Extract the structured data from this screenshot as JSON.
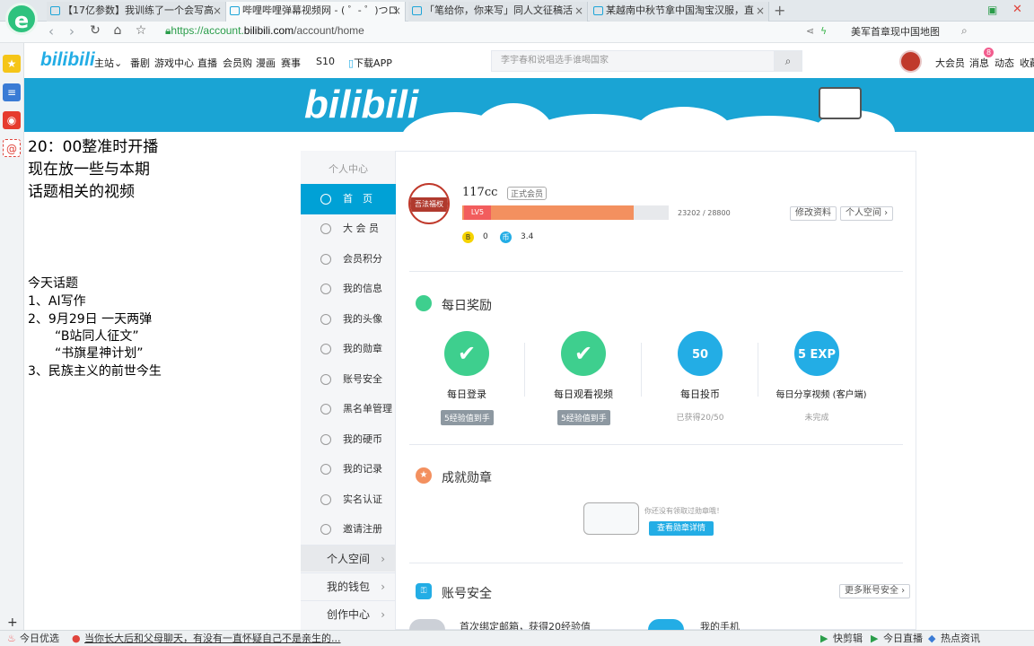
{
  "browser": {
    "tabs": [
      {
        "title": "【17亿参数】我训练了一个会写高"
      },
      {
        "title": "哔哩哔哩弹幕视频网 - ( ゜- ゜)つロ"
      },
      {
        "title": "「笔给你，你来写」同人文征稿活"
      },
      {
        "title": "某越南中秋节拿中国淘宝汉服，直"
      }
    ],
    "url_scheme": "https://account.",
    "url_domain": "bilibili.com",
    "url_path": "/account/home",
    "search_text": "美军首章现中国地图",
    "status_items": [
      "今日优选",
      "当你长大后和父母聊天，有没有一直怀疑自己不是亲生的...",
      "快剪辑",
      "今日直播",
      "热点资讯"
    ]
  },
  "site_header": {
    "logo": "bilibili",
    "nav": [
      "主站",
      "番剧",
      "游戏中心",
      "直播",
      "会员购",
      "漫画",
      "赛事",
      "S10",
      "下载APP"
    ],
    "search_placeholder": "李宇春和说唱选手谁喝国家",
    "right_links": [
      "大会员",
      "消息",
      "动态",
      "收藏"
    ],
    "message_count": "8"
  },
  "banner": {
    "logo": "bilibili"
  },
  "notes": {
    "line1": "20：00整准时开播",
    "line2": "现在放一些与本期",
    "line3": "话题相关的视频",
    "topics_title": "今天话题",
    "topic1": "1、AI写作",
    "topic2": "2、9月29日 一天两弹",
    "topic2a": "“B站同人征文”",
    "topic2b": "“书旗星神计划”",
    "topic3": "3、民族主义的前世今生"
  },
  "account_nav": {
    "header": "个人中心",
    "items": [
      "首　页",
      "大 会 员",
      "会员积分",
      "我的信息",
      "我的头像",
      "我的勋章",
      "账号安全",
      "黑名单管理",
      "我的硬币",
      "我的记录",
      "实名认证",
      "邀请注册"
    ],
    "bottom": [
      "个人空间",
      "我的钱包",
      "创作中心"
    ]
  },
  "profile": {
    "name": "117cc",
    "member_tag": "正式会员",
    "level": "LV5",
    "exp_progress": 0.83,
    "exp_text": "23202 / 28800",
    "bcoin": "0",
    "coin": "3.4",
    "edit_btn": "修改资料",
    "space_btn": "个人空间",
    "avatar_text": "吾法福权"
  },
  "daily": {
    "title": "每日奖励",
    "items": [
      {
        "label": "每日登录",
        "status": "5经验值到手",
        "icon": "check-icon",
        "color": "#3ecf8e"
      },
      {
        "label": "每日观看视频",
        "status": "5经验值到手",
        "icon": "check-icon",
        "color": "#3ecf8e"
      },
      {
        "label": "每日投币",
        "status": "已获得20/50",
        "icon": "50 EXP",
        "color": "#23ade5"
      },
      {
        "label": "每日分享视频 (客户端)",
        "status": "未完成",
        "icon": "5 EXP",
        "color": "#23ade5"
      }
    ]
  },
  "medals": {
    "title": "成就勋章",
    "empty_text": "你还没有领取过勋章哦！",
    "button": "查看勋章详情"
  },
  "security": {
    "title": "账号安全",
    "more_btn": "更多账号安全",
    "item1": "首次绑定邮箱，获得20经验值",
    "item2": "我的手机"
  }
}
